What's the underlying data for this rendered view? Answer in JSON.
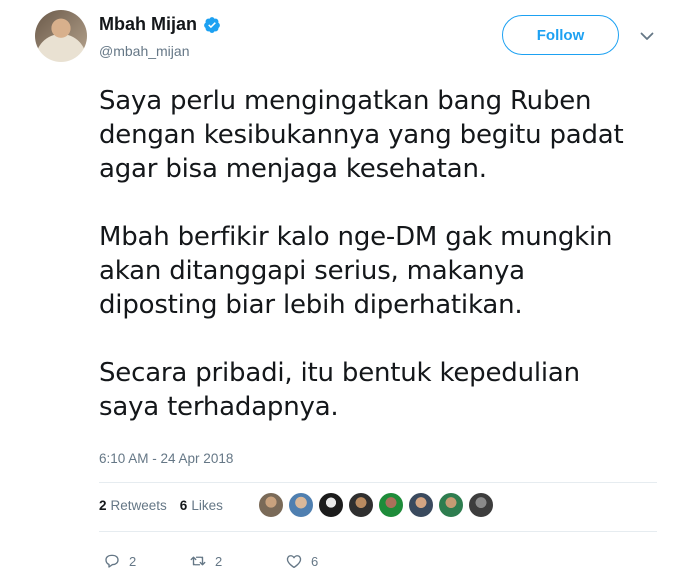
{
  "tweet": {
    "author": {
      "display_name": "Mbah Mijan",
      "handle": "@mbah_mijan",
      "verified_icon": "verified-badge-icon"
    },
    "follow_label": "Follow",
    "paragraphs": [
      [
        "Saya perlu mengingatkan bang Ruben",
        "dengan kesibukannya yang begitu padat",
        "agar bisa menjaga kesehatan."
      ],
      [
        "Mbah berfikir kalo nge-DM gak mungkin",
        "akan ditanggapi serius, makanya",
        "diposting biar lebih diperhatikan."
      ],
      [
        "Secara pribadi, itu bentuk kepedulian",
        "saya terhadapnya."
      ]
    ],
    "timestamp": "6:10 AM - 24 Apr 2018",
    "stats": {
      "retweets_count": "2",
      "retweets_label": "Retweets",
      "likes_count": "6",
      "likes_label": "Likes"
    },
    "likers_avatar_count": 8,
    "actions": {
      "reply_count": "2",
      "retweet_count": "2",
      "like_count": "6"
    },
    "colors": {
      "accent": "#1da1f2",
      "text": "#14171a",
      "secondary": "#657786",
      "divider": "#e6ecf0"
    }
  }
}
